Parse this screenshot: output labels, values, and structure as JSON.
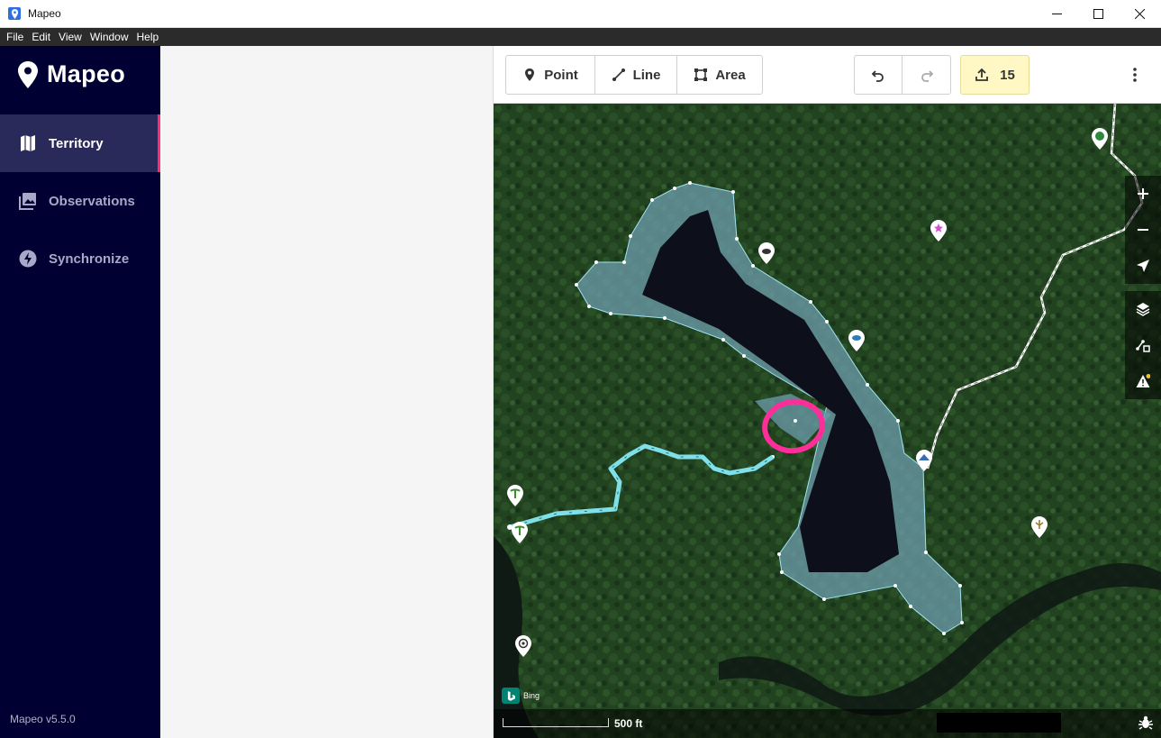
{
  "window": {
    "title": "Mapeo"
  },
  "menu": [
    "File",
    "Edit",
    "View",
    "Window",
    "Help"
  ],
  "sidebar": {
    "brand": "Mapeo",
    "items": [
      {
        "label": "Territory",
        "icon": "map-icon",
        "active": true
      },
      {
        "label": "Observations",
        "icon": "photo-icon",
        "active": false
      },
      {
        "label": "Synchronize",
        "icon": "bolt-icon",
        "active": false
      }
    ],
    "version": "Mapeo v5.5.0"
  },
  "toolbar": {
    "point_label": "Point",
    "line_label": "Line",
    "area_label": "Area",
    "upload_count": "15"
  },
  "map": {
    "attribution": "Bing",
    "scale_label": "500 ft",
    "colors": {
      "area_fill": "#6a9aa8",
      "area_stroke": "#9fe3f0",
      "river_line": "#7fe0ea",
      "trail_line": "#ffffff",
      "highlight_circle": "#ff2d9a"
    }
  }
}
